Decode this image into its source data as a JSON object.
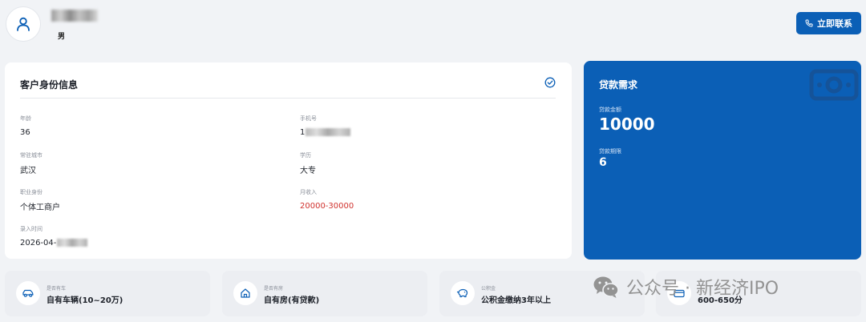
{
  "header": {
    "gender": "男",
    "contact_label": "立即联系",
    "colors": {
      "primary": "#0b5fb6"
    }
  },
  "profile": {
    "title": "客户身份信息",
    "fields": {
      "age": {
        "label": "年龄",
        "value": "36"
      },
      "phone": {
        "label": "手机号",
        "value": "1"
      },
      "city": {
        "label": "常驻城市",
        "value": "武汉"
      },
      "edu": {
        "label": "学历",
        "value": "大专"
      },
      "job": {
        "label": "职业身份",
        "value": "个体工商户"
      },
      "income": {
        "label": "月收入",
        "value": "20000-30000"
      },
      "entry": {
        "label": "录入时间",
        "value": "2026-04-"
      }
    },
    "colors": {
      "income": "#d0312d"
    }
  },
  "loan": {
    "title": "贷款需求",
    "amount_label": "贷款金额",
    "amount": "10000",
    "term_label": "贷款期限",
    "term": "6"
  },
  "assets": [
    {
      "icon": "car-icon",
      "label": "是否有车",
      "value": "自有车辆(10~20万)"
    },
    {
      "icon": "house-icon",
      "label": "是否有房",
      "value": "自有房(有贷款)"
    },
    {
      "icon": "piggy-bank-icon",
      "label": "公积金",
      "value": "公积金缴纳3年以上"
    },
    {
      "icon": "card-icon",
      "label": "",
      "value": "600-650分"
    }
  ],
  "watermark": {
    "text": "公众号 · 新经济IPO"
  }
}
